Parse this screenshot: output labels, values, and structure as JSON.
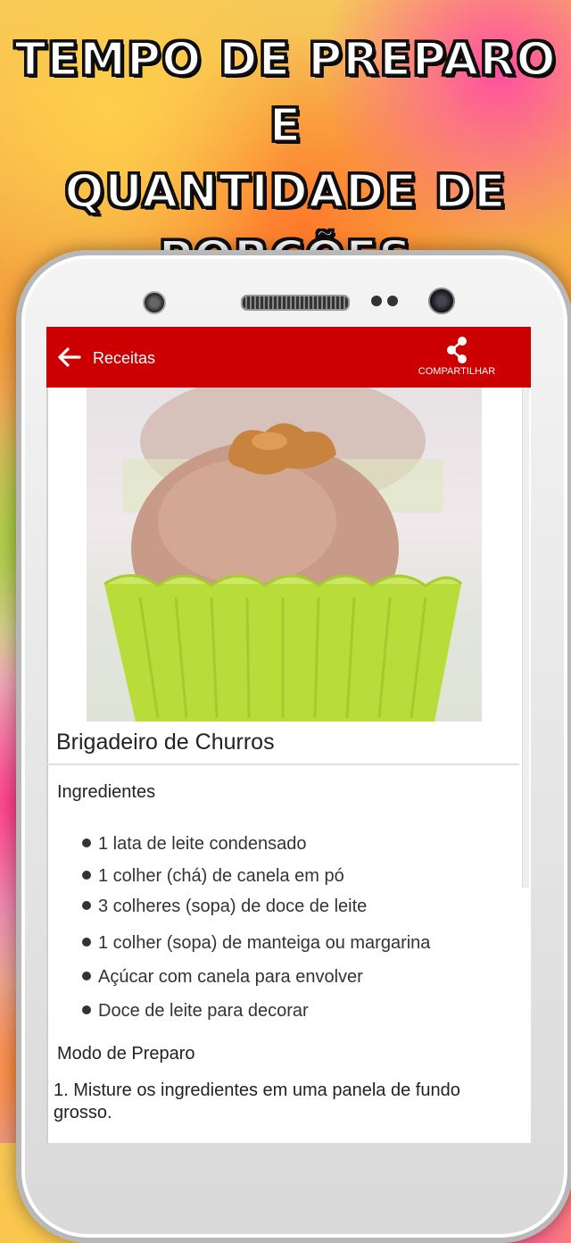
{
  "promo": {
    "headline_line1": "TEMPO DE PREPARO E",
    "headline_line2": "QUANTIDADE DE",
    "headline_line3": "PORÇÕES"
  },
  "appbar": {
    "title": "Receitas",
    "back_icon": "arrow-left-icon",
    "share_label": "COMPARTILHAR",
    "share_icon": "share-icon",
    "color": "#cc0000"
  },
  "recipe": {
    "image_icon": "cupcake-photo",
    "title": "Brigadeiro de Churros",
    "ingredients_heading": "Ingredientes",
    "ingredients": [
      "1 lata de leite condensado",
      "1 colher (chá) de canela em pó",
      "3 colheres (sopa) de doce de leite",
      "1 colher (sopa) de manteiga ou margarina",
      "Açúcar com canela para envolver",
      "Doce de leite para decorar"
    ],
    "method_heading": "Modo de Preparo",
    "steps": [
      "1. Misture os ingredientes em uma panela de fundo grosso."
    ]
  }
}
